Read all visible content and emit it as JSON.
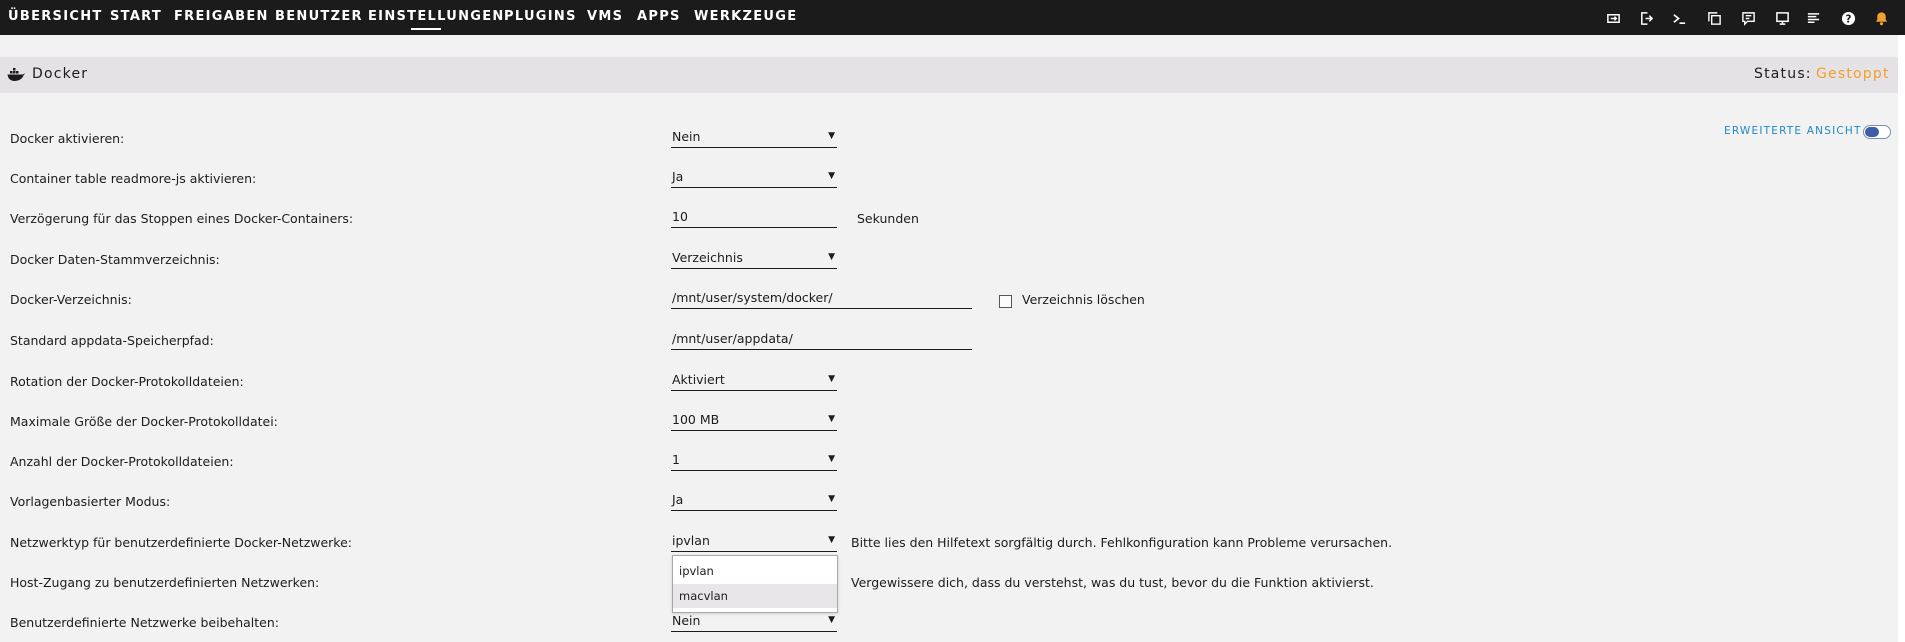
{
  "nav": {
    "items": [
      "ÜBERSICHT",
      "START",
      "FREIGABEN",
      "BENUTZER",
      "EINSTELLUNGEN",
      "PLUGINS",
      "VMS",
      "APPS",
      "WERKZEUGE"
    ],
    "active": "EINSTELLUNGEN",
    "icons": [
      "switch-view-icon",
      "logout-icon",
      "terminal-icon",
      "copy-windows-icon",
      "feedback-icon",
      "monitor-icon",
      "log-icon",
      "help-icon",
      "bell-icon"
    ]
  },
  "header": {
    "title": "Docker",
    "status_label": "Status:",
    "status_value": "Gestoppt",
    "status_color": "#f0a030"
  },
  "advanced_view": {
    "label": "ERWEITERTE ANSICHT",
    "enabled": true,
    "accent": "#3f5ea8"
  },
  "form": {
    "docker_enable": {
      "label": "Docker aktivieren:",
      "value": "Nein"
    },
    "readmore": {
      "label": "Container table readmore-js aktivieren:",
      "value": "Ja"
    },
    "stop_delay": {
      "label": "Verzögerung für das Stoppen eines Docker-Containers:",
      "value": "10",
      "unit": "Sekunden"
    },
    "data_root": {
      "label": "Docker Daten-Stammverzeichnis:",
      "value": "Verzeichnis"
    },
    "directory": {
      "label": "Docker-Verzeichnis:",
      "value": "/mnt/user/system/docker/",
      "checkbox_label": "Verzeichnis löschen"
    },
    "appdata": {
      "label": "Standard appdata-Speicherpfad:",
      "value": "/mnt/user/appdata/"
    },
    "log_rotation": {
      "label": "Rotation der Docker-Protokolldateien:",
      "value": "Aktiviert"
    },
    "log_size": {
      "label": "Maximale Größe der Docker-Protokolldatei:",
      "value": "100 MB"
    },
    "log_count": {
      "label": "Anzahl der Docker-Protokolldateien:",
      "value": "1"
    },
    "template_mode": {
      "label": "Vorlagenbasierter Modus:",
      "value": "Ja"
    },
    "network_type": {
      "label": "Netzwerktyp für benutzerdefinierte Docker-Netzwerke:",
      "value": "ipvlan",
      "hint": "Bitte lies den Hilfetext sorgfältig durch. Fehlkonfiguration kann Probleme verursachen.",
      "options": [
        "ipvlan",
        "macvlan"
      ]
    },
    "host_access": {
      "label": "Host-Zugang zu benutzerdefinierten Netzwerken:",
      "hint": "Vergewissere dich, dass du verstehst, was du tust, bevor du die Funktion aktivierst."
    },
    "preserve_networks": {
      "label": "Benutzerdefinierte Netzwerke beibehalten:",
      "value": "Nein"
    }
  }
}
